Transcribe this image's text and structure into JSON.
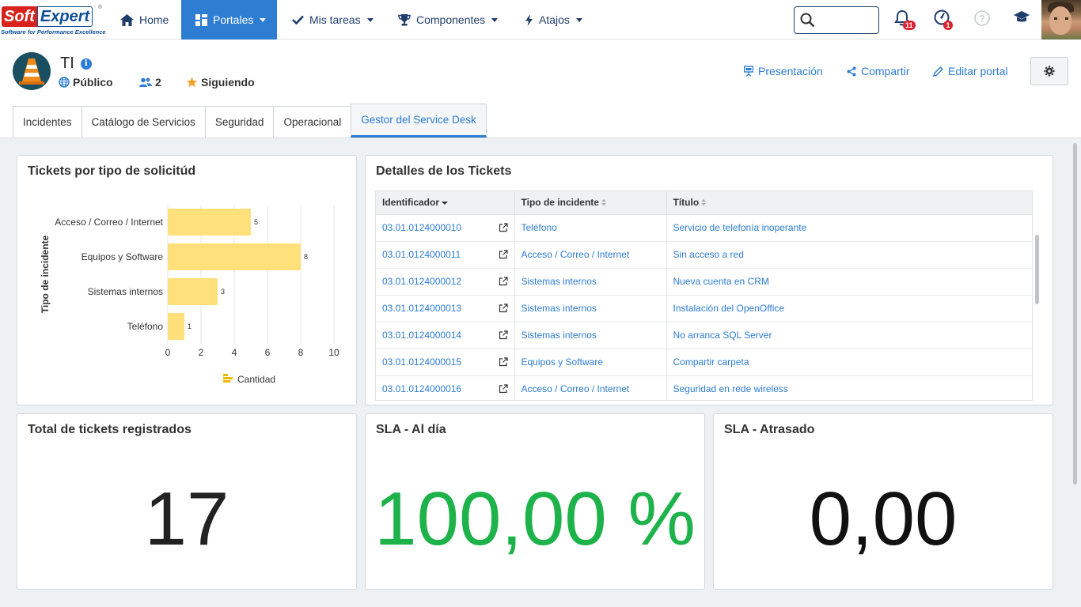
{
  "brand": {
    "logo_part1": "Soft",
    "logo_part2": "Expert",
    "registered": "®",
    "tagline": "Software for Performance Excellence"
  },
  "navbar": {
    "items": [
      {
        "label": "Home",
        "icon": "home-icon"
      },
      {
        "label": "Portales",
        "icon": "grid-icon",
        "active": true
      },
      {
        "label": "Mis tareas",
        "icon": "check-icon"
      },
      {
        "label": "Componentes",
        "icon": "trophy-icon"
      },
      {
        "label": "Atajos",
        "icon": "bolt-icon"
      }
    ],
    "search_value": "",
    "notifications_count": "11",
    "tasks_count": "1",
    "colors": {
      "accent": "#2d7dd2",
      "nav_text": "#1f3d6b",
      "badge": "#d9232f"
    }
  },
  "portal": {
    "title": "TI",
    "visibility": "Público",
    "members": "2",
    "following": "Siguiendo",
    "actions": {
      "presentation": "Presentación",
      "share": "Compartir",
      "edit": "Editar portal"
    },
    "tabs": [
      {
        "label": "Incidentes"
      },
      {
        "label": "Catálogo de Servicios"
      },
      {
        "label": "Seguridad"
      },
      {
        "label": "Operacional"
      },
      {
        "label": "Gestor del Service Desk",
        "active": true
      }
    ]
  },
  "widgets": {
    "chart_title": "Tickets por tipo de solicitúd",
    "table_title": "Detalles de los Tickets",
    "total_title": "Total de tickets registrados",
    "total_value": "17",
    "sla_ok_title": "SLA - Al día",
    "sla_ok_value": "100,00 %",
    "sla_late_title": "SLA - Atrasado",
    "sla_late_value": "0,00",
    "colors": {
      "sla_ok": "#1db34a",
      "kpi": "#222222",
      "bar": "#ffe07a"
    }
  },
  "chart_data": {
    "type": "bar",
    "orientation": "horizontal",
    "title": "",
    "categories": [
      "Acceso / Correo / Internet",
      "Equipos y Software",
      "Sistemas internos",
      "Teléfono"
    ],
    "values": [
      5,
      8,
      3,
      1
    ],
    "xlabel": "",
    "ylabel": "Tipo de incidente",
    "xlim": [
      0,
      10
    ],
    "xticks": [
      0,
      2,
      4,
      6,
      8,
      10
    ],
    "legend": {
      "entries": [
        "Cantidad"
      ],
      "position": "bottom"
    },
    "grid": true,
    "data_labels": true
  },
  "table": {
    "columns": [
      {
        "label": "Identificador",
        "sort": "desc"
      },
      {
        "label": "Tipo de incidente",
        "sort": "none"
      },
      {
        "label": "Título",
        "sort": "none"
      }
    ],
    "rows": [
      {
        "id": "03.01.0124000010",
        "type": "Teléfono",
        "title": "Servicio de telefonía inoperante"
      },
      {
        "id": "03.01.0124000011",
        "type": "Acceso / Correo / Internet",
        "title": "Sin acceso a red"
      },
      {
        "id": "03.01.0124000012",
        "type": "Sistemas internos",
        "title": "Nueva cuenta en CRM"
      },
      {
        "id": "03.01.0124000013",
        "type": "Sistemas internos",
        "title": "Instalación del OpenOffice"
      },
      {
        "id": "03.01.0124000014",
        "type": "Sistemas internos",
        "title": "No arranca SQL Server"
      },
      {
        "id": "03.01.0124000015",
        "type": "Equipos y Software",
        "title": "Compartir carpeta"
      },
      {
        "id": "03.01.0124000016",
        "type": "Acceso / Correo / Internet",
        "title": "Seguridad en rede wireless"
      }
    ]
  }
}
